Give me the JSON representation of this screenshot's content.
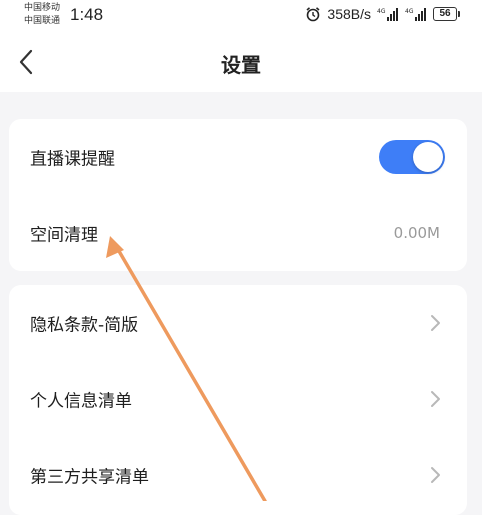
{
  "status_bar": {
    "carrier_1": "中国移动",
    "carrier_2": "中国联通",
    "time": "1:48",
    "network_speed": "358B/s",
    "battery": "56",
    "icons": [
      "alarm-icon",
      "signal-4g-icon",
      "signal-4g-icon",
      "battery-icon"
    ]
  },
  "nav": {
    "title": "设置",
    "back_icon": "back-chevron-icon"
  },
  "settings_group_1": {
    "live_reminder": {
      "label": "直播课提醒",
      "toggle_on": true
    },
    "space_cleanup": {
      "label": "空间清理",
      "value": "0.00M"
    }
  },
  "settings_group_2": {
    "items": [
      {
        "label": "隐私条款-简版"
      },
      {
        "label": "个人信息清单"
      },
      {
        "label": "第三方共享清单"
      }
    ]
  },
  "colors": {
    "toggle_active": "#3e7ef7",
    "annotation_arrow": "#ee9a5e",
    "background": "#f5f5f7"
  }
}
